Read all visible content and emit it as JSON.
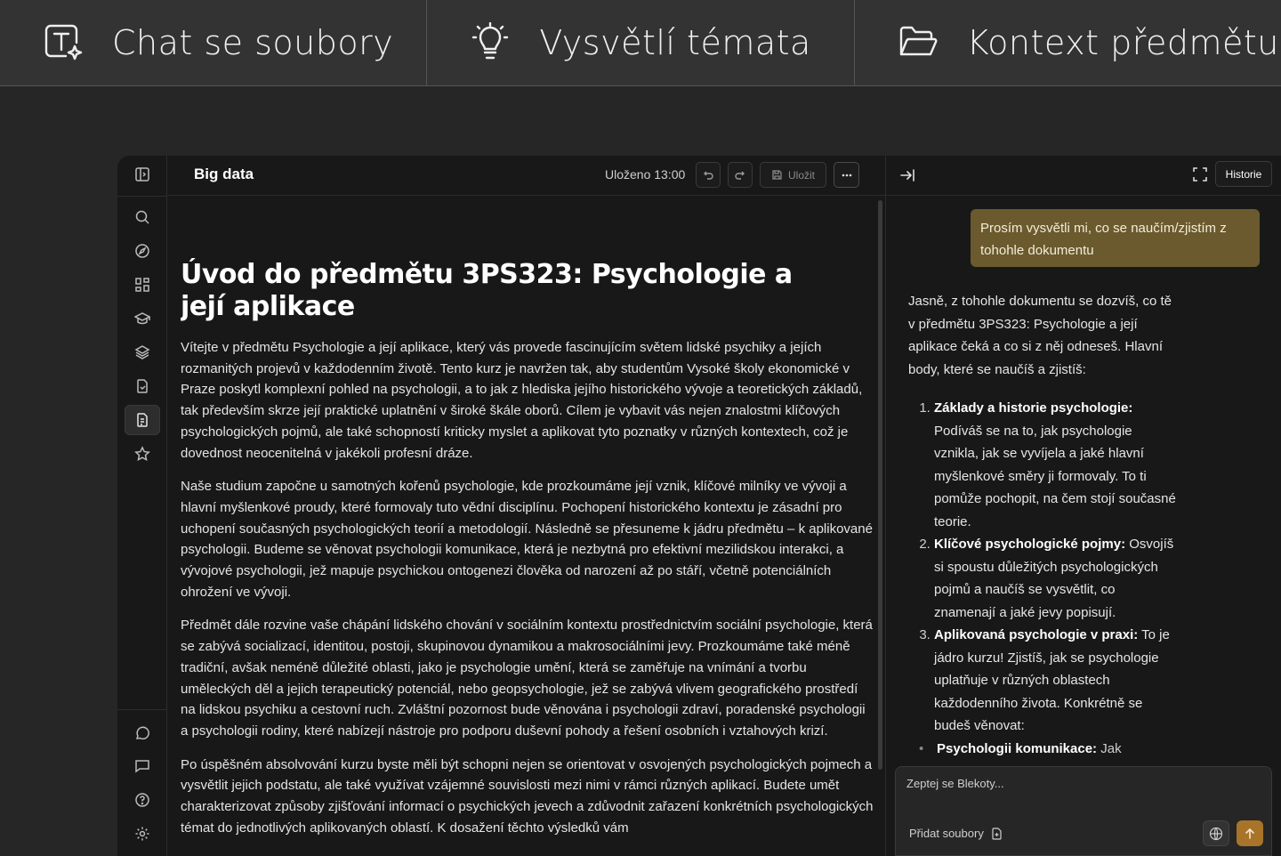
{
  "features": [
    {
      "label": "Chat se soubory",
      "icon": "text-sparkle-icon"
    },
    {
      "label": "Vysvětlí témata",
      "icon": "lightbulb-icon"
    },
    {
      "label": "Kontext předmětu",
      "icon": "folder-open-icon"
    }
  ],
  "rail": {
    "icons": [
      "sidebar-toggle-icon",
      "search-icon",
      "compass-icon",
      "grid-icon",
      "graduation-cap-icon",
      "layers-icon",
      "file-check-icon",
      "document-icon",
      "star-icon",
      "chat-bubble-icon",
      "message-square-icon",
      "help-icon",
      "settings-icon"
    ]
  },
  "editor": {
    "doc_name": "Big data",
    "saved_status": "Uloženo 13:00",
    "save_label": "Uložit",
    "title": "Úvod do předmětu 3PS323: Psychologie a její aplikace",
    "paragraphs": [
      "Vítejte v předmětu Psychologie a její aplikace, který vás provede fascinujícím světem lidské psychiky a jejích rozmanitých projevů v každodenním životě. Tento kurz je navržen tak, aby studentům Vysoké školy ekonomické v Praze poskytl komplexní pohled na psychologii, a to jak z hlediska jejího historického vývoje a teoretických základů, tak především skrze její praktické uplatnění v široké škále oborů. Cílem je vybavit vás nejen znalostmi klíčových psychologických pojmů, ale také schopností kriticky myslet a aplikovat tyto poznatky v různých kontextech, což je dovednost neocenitelná v jakékoli profesní dráze.",
      "Naše studium započne u samotných kořenů psychologie, kde prozkoumáme její vznik, klíčové milníky ve vývoji a hlavní myšlenkové proudy, které formovaly tuto vědní disciplínu. Pochopení historického kontextu je zásadní pro uchopení současných psychologických teorií a metodologií. Následně se přesuneme k jádru předmětu – k aplikované psychologii. Budeme se věnovat psychologii komunikace, která je nezbytná pro efektivní mezilidskou interakci, a vývojové psychologii, jež mapuje psychickou ontogenezi člověka od narození až po stáří, včetně potenciálních ohrožení ve vývoji.",
      "Předmět dále rozvine vaše chápání lidského chování v sociálním kontextu prostřednictvím sociální psychologie, která se zabývá socializací, identitou, postoji, skupinovou dynamikou a makrosociálními jevy. Prozkoumáme také méně tradiční, avšak neméně důležité oblasti, jako je psychologie umění, která se zaměřuje na vnímání a tvorbu uměleckých děl a jejich terapeutický potenciál, nebo geopsychologie, jež se zabývá vlivem geografického prostředí na lidskou psychiku a cestovní ruch. Zvláštní pozornost bude věnována i psychologii zdraví, poradenské psychologii a psychologii rodiny, které nabízejí nástroje pro podporu duševní pohody a řešení osobních i vztahových krizí.",
      "Po úspěšném absolvování kurzu byste měli být schopni nejen se orientovat v osvojených psychologických pojmech a vysvětlit jejich podstatu, ale také využívat vzájemné souvislosti mezi nimi v rámci různých aplikací. Budete umět charakterizovat způsoby zjišťování informací o psychických jevech a zdůvodnit zařazení konkrétních psychologických témat do jednotlivých aplikovaných oblastí. K dosažení těchto výsledků vám"
    ]
  },
  "chat": {
    "history_label": "Historie",
    "user_message": "Prosím vysvětli mi, co se naučím/zjistím z tohohle dokumentu",
    "answer_intro": "Jasně, z tohohle dokumentu se dozvíš, co tě v předmětu 3PS323: Psychologie a její aplikace čeká a co si z něj odneseš. Hlavní body, které se naučíš a zjistíš:",
    "points": [
      {
        "title": "Základy a historie psychologie:",
        "text": " Podíváš se na to, jak psychologie vznikla, jak se vyvíjela a jaké hlavní myšlenkové směry ji formovaly. To ti pomůže pochopit, na čem stojí současné teorie."
      },
      {
        "title": "Klíčové psychologické pojmy:",
        "text": " Osvojíš si spoustu důležitých psychologických pojmů a naučíš se vysvětlit, co znamenají a jaké jevy popisují."
      },
      {
        "title": "Aplikovaná psychologie v praxi:",
        "text": " To je jádro kurzu! Zjistíš, jak se psychologie uplatňuje v různých oblastech každodenního života. Konkrétně se budeš věnovat:"
      }
    ],
    "subpoint_title": "Psychologii komunikace:",
    "subpoint_text": " Jak",
    "input_placeholder": "Zeptej se Blekoty...",
    "add_files_label": "Přidat soubory",
    "accent_color": "#a8742a"
  }
}
